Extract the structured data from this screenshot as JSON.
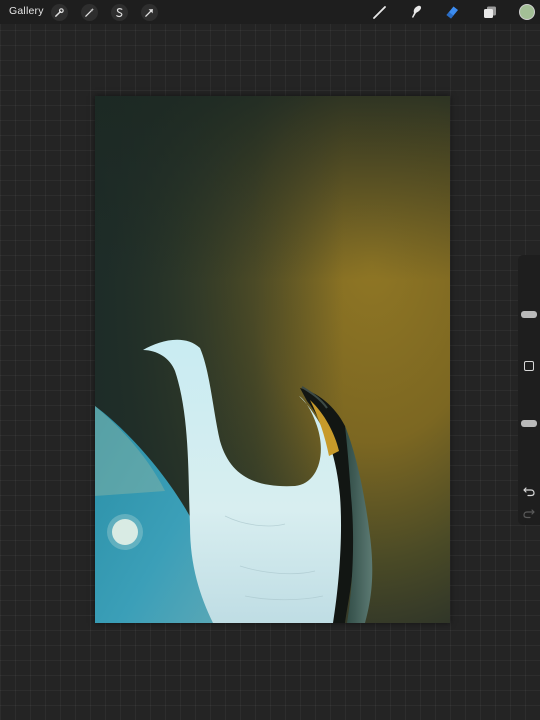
{
  "toolbar": {
    "gallery_label": "Gallery",
    "left_tools": [
      "wrench-icon",
      "magic-wand-icon",
      "selection-s-icon",
      "transform-arrow-icon"
    ],
    "right_tools": [
      "brush-icon",
      "smudge-icon",
      "eraser-icon",
      "layers-icon"
    ],
    "active_tool": "eraser",
    "active_color": "#a3bf96"
  },
  "sidebar": {
    "brush_size": 0.4,
    "opacity": 0.55,
    "icons": [
      "modify-square-icon",
      "undo-icon",
      "redo-icon"
    ]
  },
  "colors": {
    "accent": "#3c8cf0",
    "ui_background": "#242424",
    "toolbar_background": "#1e1e1e"
  }
}
